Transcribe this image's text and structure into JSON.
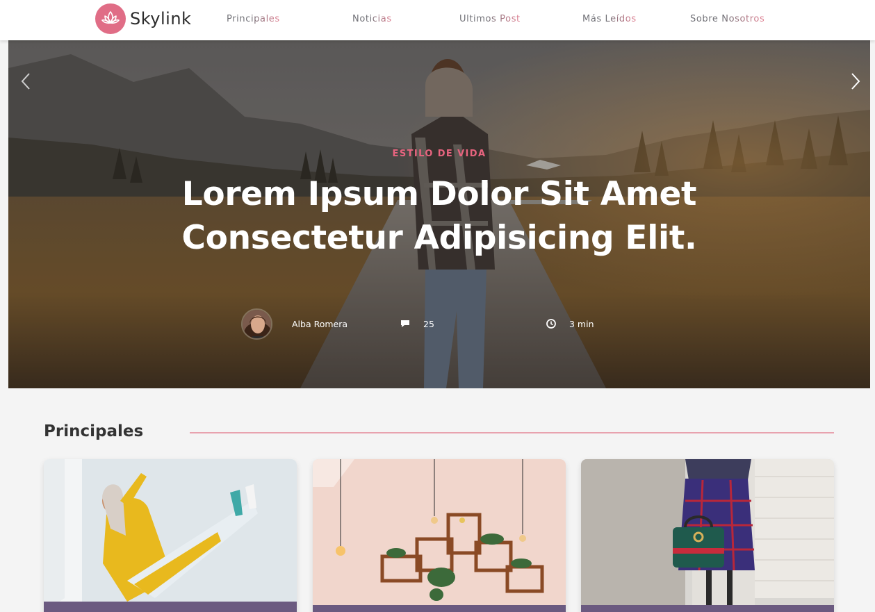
{
  "brand": {
    "name": "Skylink",
    "color": "#e06d86"
  },
  "nav": {
    "items": [
      {
        "label": "Principales"
      },
      {
        "label": "Noticias"
      },
      {
        "label": "Últimos Post"
      },
      {
        "label": "Más Leídos"
      },
      {
        "label": "Sobre Nosotros"
      }
    ]
  },
  "hero": {
    "category": "ESTILO DE VIDA",
    "title": "Lorem Ipsum Dolor Sit Amet Consectetur Adipisicing Elit.",
    "author": "Alba Romera",
    "comments": "25",
    "read_time": "3 min",
    "icons": [
      "chevron-left-icon",
      "chevron-right-icon",
      "comment-icon",
      "clock-icon"
    ]
  },
  "section": {
    "title": "Principales"
  },
  "cards": [
    {
      "image": "woman-yellow-outfit-image"
    },
    {
      "image": "wall-shelves-interior-image"
    },
    {
      "image": "street-fashion-handbag-image"
    }
  ],
  "colors": {
    "accent": "#e8647f",
    "section_line": "#e8a2ae",
    "card_bottom_band": "#6b5a80"
  }
}
